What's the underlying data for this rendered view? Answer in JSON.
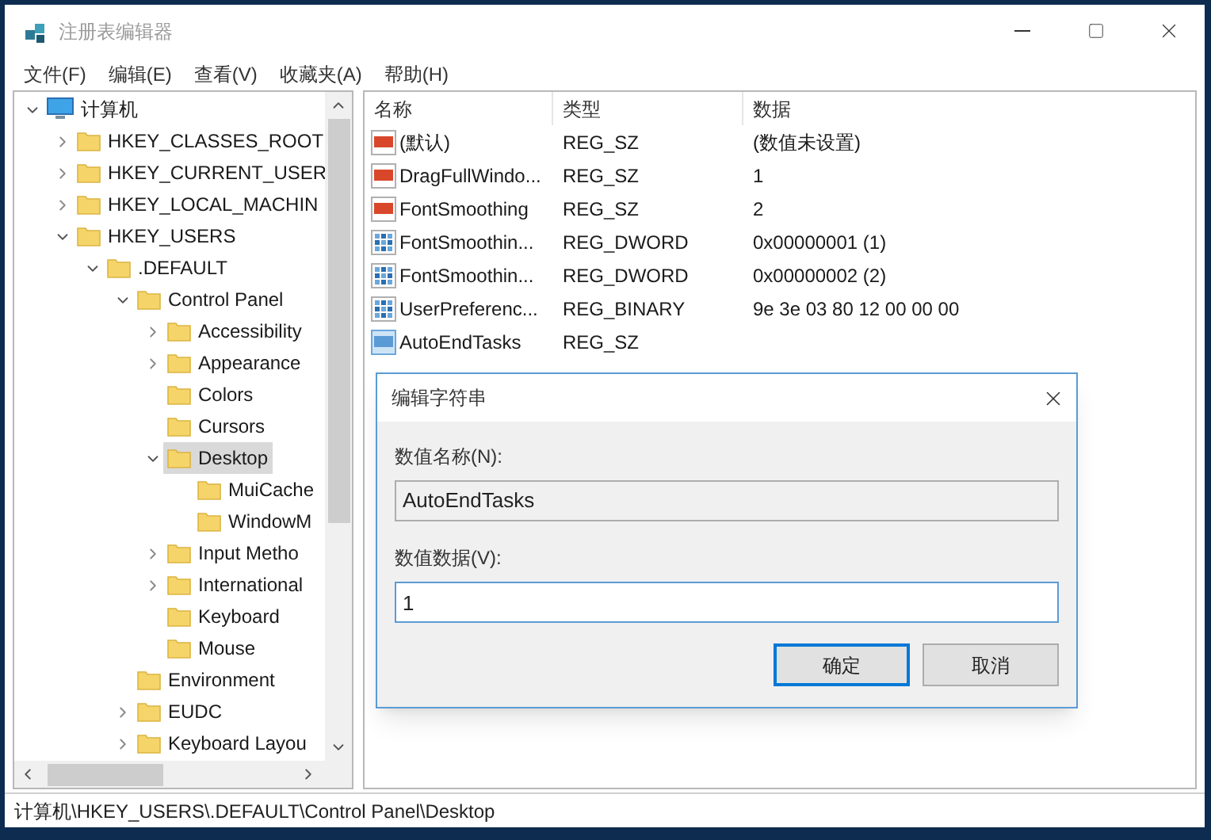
{
  "window": {
    "title": "注册表编辑器"
  },
  "menu": [
    "文件(F)",
    "编辑(E)",
    "查看(V)",
    "收藏夹(A)",
    "帮助(H)"
  ],
  "tree": {
    "items": [
      {
        "label": "计算机",
        "kind": "computer",
        "expanded": true,
        "selected": false,
        "children": [
          {
            "label": "HKEY_CLASSES_ROOT",
            "kind": "folder",
            "expanded": false,
            "selected": false
          },
          {
            "label": "HKEY_CURRENT_USER",
            "kind": "folder",
            "expanded": false,
            "selected": false
          },
          {
            "label": "HKEY_LOCAL_MACHIN",
            "kind": "folder",
            "expanded": false,
            "selected": false
          },
          {
            "label": "HKEY_USERS",
            "kind": "folder",
            "expanded": true,
            "selected": false,
            "children": [
              {
                "label": ".DEFAULT",
                "kind": "folder",
                "expanded": true,
                "selected": false,
                "children": [
                  {
                    "label": "Control Panel",
                    "kind": "folder",
                    "expanded": true,
                    "selected": false,
                    "children": [
                      {
                        "label": "Accessibility",
                        "kind": "folder",
                        "expanded": false,
                        "selected": false
                      },
                      {
                        "label": "Appearance",
                        "kind": "folder",
                        "expanded": false,
                        "selected": false
                      },
                      {
                        "label": "Colors",
                        "kind": "folder",
                        "selected": false
                      },
                      {
                        "label": "Cursors",
                        "kind": "folder",
                        "selected": false
                      },
                      {
                        "label": "Desktop",
                        "kind": "folder",
                        "expanded": true,
                        "selected": true,
                        "children": [
                          {
                            "label": "MuiCache",
                            "kind": "folder",
                            "selected": false
                          },
                          {
                            "label": "WindowM",
                            "kind": "folder",
                            "selected": false
                          }
                        ]
                      },
                      {
                        "label": "Input Metho",
                        "kind": "folder",
                        "expanded": false,
                        "selected": false
                      },
                      {
                        "label": "International",
                        "kind": "folder",
                        "expanded": false,
                        "selected": false
                      },
                      {
                        "label": "Keyboard",
                        "kind": "folder",
                        "selected": false
                      },
                      {
                        "label": "Mouse",
                        "kind": "folder",
                        "selected": false
                      }
                    ]
                  },
                  {
                    "label": "Environment",
                    "kind": "folder",
                    "selected": false
                  },
                  {
                    "label": "EUDC",
                    "kind": "folder",
                    "expanded": false,
                    "selected": false
                  },
                  {
                    "label": "Keyboard Layou",
                    "kind": "folder",
                    "expanded": false,
                    "selected": false
                  }
                ]
              }
            ]
          }
        ]
      }
    ]
  },
  "list": {
    "columns": [
      "名称",
      "类型",
      "数据"
    ],
    "rows": [
      {
        "name": "(默认)",
        "type": "REG_SZ",
        "data": "(数值未设置)",
        "kind": "string",
        "selected": false
      },
      {
        "name": "DragFullWindo...",
        "type": "REG_SZ",
        "data": "1",
        "kind": "string",
        "selected": false
      },
      {
        "name": "FontSmoothing",
        "type": "REG_SZ",
        "data": "2",
        "kind": "string",
        "selected": false
      },
      {
        "name": "FontSmoothin...",
        "type": "REG_DWORD",
        "data": "0x00000001 (1)",
        "kind": "binary",
        "selected": false
      },
      {
        "name": "FontSmoothin...",
        "type": "REG_DWORD",
        "data": "0x00000002 (2)",
        "kind": "binary",
        "selected": false
      },
      {
        "name": "UserPreferenc...",
        "type": "REG_BINARY",
        "data": "9e 3e 03 80 12 00 00 00",
        "kind": "binary",
        "selected": false
      },
      {
        "name": "AutoEndTasks",
        "type": "REG_SZ",
        "kind": "string",
        "selected": true
      }
    ]
  },
  "dialog": {
    "title": "编辑字符串",
    "name_label": "数值名称(N):",
    "name_value": "AutoEndTasks",
    "data_label": "数值数据(V):",
    "data_value": "1",
    "buttons": [
      {
        "label": "确定",
        "default": true
      },
      {
        "label": "取消",
        "default": false
      }
    ]
  },
  "status_bar": "计算机\\HKEY_USERS\\.DEFAULT\\Control Panel\\Desktop"
}
